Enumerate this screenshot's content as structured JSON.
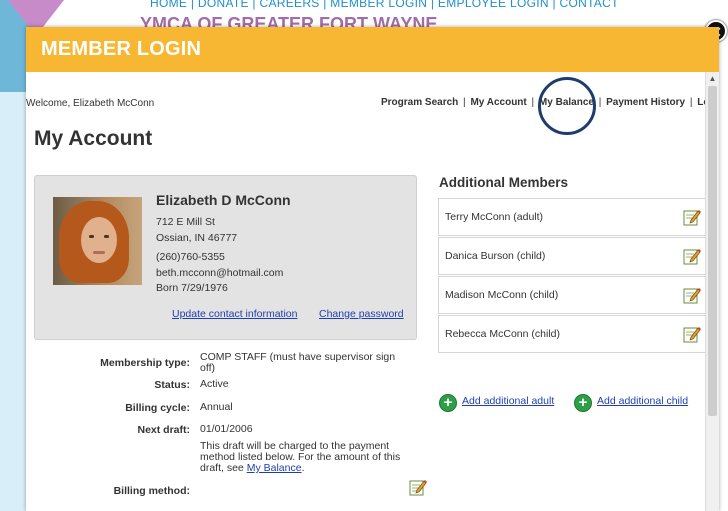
{
  "background": {
    "nav_text": "HOME | DONATE | CAREERS | MEMBER LOGIN | EMPLOYEE LOGIN | CONTACT",
    "site_title": "YMCA OF GREATER FORT WAYNE"
  },
  "modal": {
    "title": "MEMBER LOGIN",
    "close_icon": "close-icon"
  },
  "header": {
    "welcome": "Welcome, Elizabeth McConn",
    "links": [
      "Program Search",
      "My Account",
      "My Balance",
      "Payment History",
      "Logo"
    ],
    "separator": "|"
  },
  "page_title": "My Account",
  "profile": {
    "name": "Elizabeth D McConn",
    "address1": "712 E Mill St",
    "address2": "Ossian, IN 46777",
    "phone": "(260)760-5355",
    "email": "beth.mcconn@hotmail.com",
    "born": "Born 7/29/1976",
    "update_link": "Update contact information",
    "password_link": "Change password"
  },
  "details": {
    "membership_type_label": "Membership type:",
    "membership_type": "COMP STAFF (must have supervisor sign off)",
    "status_label": "Status:",
    "status": "Active",
    "billing_cycle_label": "Billing cycle:",
    "billing_cycle": "Annual",
    "next_draft_label": "Next draft:",
    "next_draft": "01/01/2006",
    "draft_note_pre": "This draft will be charged to the payment method listed below. For the amount of this draft, see",
    "draft_note_link": "My Balance",
    "draft_note_post": ".",
    "billing_method_label": "Billing method:"
  },
  "additional_members": {
    "title": "Additional Members",
    "members": [
      {
        "name": "Terry McConn (adult)"
      },
      {
        "name": "Danica Burson (child)"
      },
      {
        "name": "Madison McConn (child)"
      },
      {
        "name": "Rebecca McConn (child)"
      }
    ],
    "add_adult": "Add additional adult",
    "add_child": "Add additional child"
  },
  "colors": {
    "modal_accent": "#f7b733",
    "link": "#1f3fae",
    "highlight_circle": "#1f3d6b",
    "add_icon": "#2e9e47"
  }
}
